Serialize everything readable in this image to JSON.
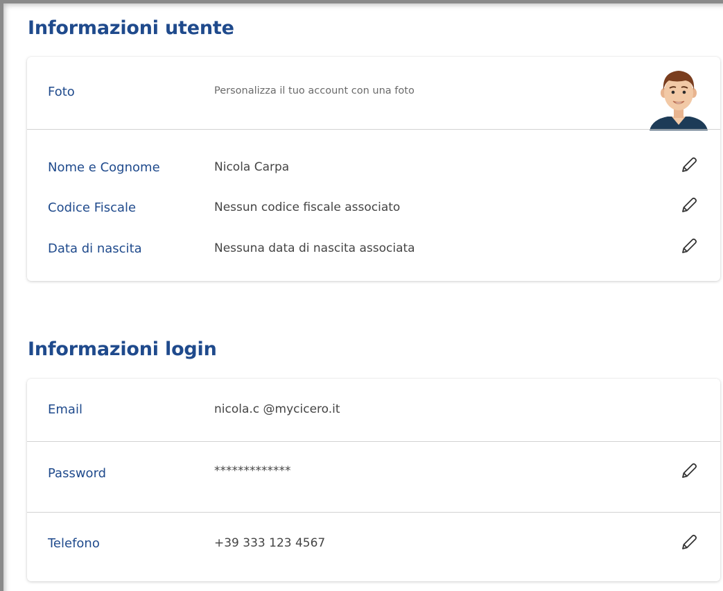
{
  "user_info": {
    "title": "Informazioni utente",
    "photo": {
      "label": "Foto",
      "description": "Personalizza il tuo account con una foto"
    },
    "fields": [
      {
        "label": "Nome e Cognome",
        "value": "Nicola Carpa"
      },
      {
        "label": "Codice Fiscale",
        "value": "Nessun codice fiscale associato"
      },
      {
        "label": "Data di nascita",
        "value": "Nessuna data di nascita associata"
      }
    ]
  },
  "login_info": {
    "title": "Informazioni login",
    "fields": [
      {
        "label": "Email",
        "value": "nicola.c @mycicero.it"
      },
      {
        "label": "Password",
        "value": "*************"
      },
      {
        "label": "Telefono",
        "value": "+39 333 123 4567"
      }
    ]
  },
  "icons": {
    "edit": "pencil-icon",
    "avatar": "avatar-icon"
  },
  "colors": {
    "heading": "#1f4a8c",
    "label": "#1f4a8c",
    "value": "#444444",
    "divider": "#d2d2d2"
  }
}
